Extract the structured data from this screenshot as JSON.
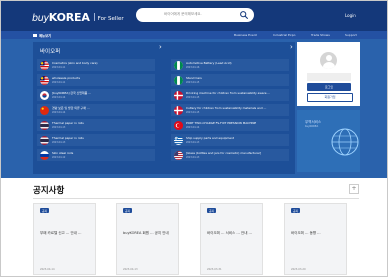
{
  "header": {
    "logo_buy": "buy",
    "logo_korea": "KOREA",
    "logo_sub": "For Seller",
    "search_placeholder": "바이어에게 문의해보세요.",
    "login_label": "Login"
  },
  "nav": {
    "menu_label": "메뉴보기",
    "links": [
      "Business Event",
      "Industrial Expo",
      "Trade Shows",
      "Support"
    ]
  },
  "inquiry": {
    "title": "바이오퍼",
    "left": [
      {
        "text": "Cosmetics (skin and body care)",
        "date": "2023-04-11",
        "flag": "malaysia"
      },
      {
        "text": "wholesale products",
        "date": "2023-04-11",
        "flag": "malaysia"
      },
      {
        "text": "[buyKOREA] 한국 산업제품 …",
        "date": "2023-04-14",
        "flag": "korea"
      },
      {
        "text": "경량 보온 및 방한 의류 구매 …",
        "date": "2023-04-14",
        "flag": "china"
      },
      {
        "text": "Thermal paper in rolls",
        "date": "2023-04-13",
        "flag": "thailand"
      },
      {
        "text": "Thermal paper in rolls",
        "date": "2023-04-13",
        "flag": "thailand"
      },
      {
        "text": "Skin steel rods",
        "date": "2023-04-12",
        "flag": "russia"
      }
    ],
    "right": [
      {
        "text": "Automotive Battery (Lead Acid)",
        "date": "2023-04-16",
        "flag": "nigeria"
      },
      {
        "text": "Stand Cars",
        "date": "2023-04-15",
        "flag": "nigeria"
      },
      {
        "text": "Drinking machine for children from sustainability aware …",
        "date": "2023-04-15",
        "flag": "denmark"
      },
      {
        "text": "Cutlery for children from sustainability materials and …",
        "date": "2023-04-15",
        "flag": "denmark"
      },
      {
        "text": "PORT TWO-CHARGE FS-FIXT PRESSION MACHINE",
        "date": "2023-04-14",
        "flag": "turkey"
      },
      {
        "text": "Ship supply parts and equipment",
        "date": "2023-04-13",
        "flag": "greece"
      },
      {
        "text": "[Glass (bottles and jars for cosmetic) manufacturer]",
        "date": "2023-04-13",
        "flag": "usa"
      }
    ]
  },
  "side": {
    "login_btn": "로그인",
    "join_btn": "회원가입",
    "promo_title": "무역서비스",
    "promo_sub": "buyKOREA"
  },
  "notices": {
    "title": "공지사항",
    "more": "+",
    "cards": [
      {
        "badge": "공지",
        "title": "부패 카르텔 신고 … 안내 …",
        "date": "2023-04-14"
      },
      {
        "badge": "공지",
        "title": "buyKOREA 회원 … 공지 안내",
        "date": "2023-04-13"
      },
      {
        "badge": "공지",
        "title": "바이오퍼 … 서비스 … 안내 …",
        "date": "2023-03-31"
      },
      {
        "badge": "공지",
        "title": "바이오퍼 … 동향 …",
        "date": "2023-03-29"
      },
      {
        "badge": "공지",
        "title": "해외 수요 … 안내 … 전시회 …",
        "date": "2023-03-15"
      }
    ]
  }
}
